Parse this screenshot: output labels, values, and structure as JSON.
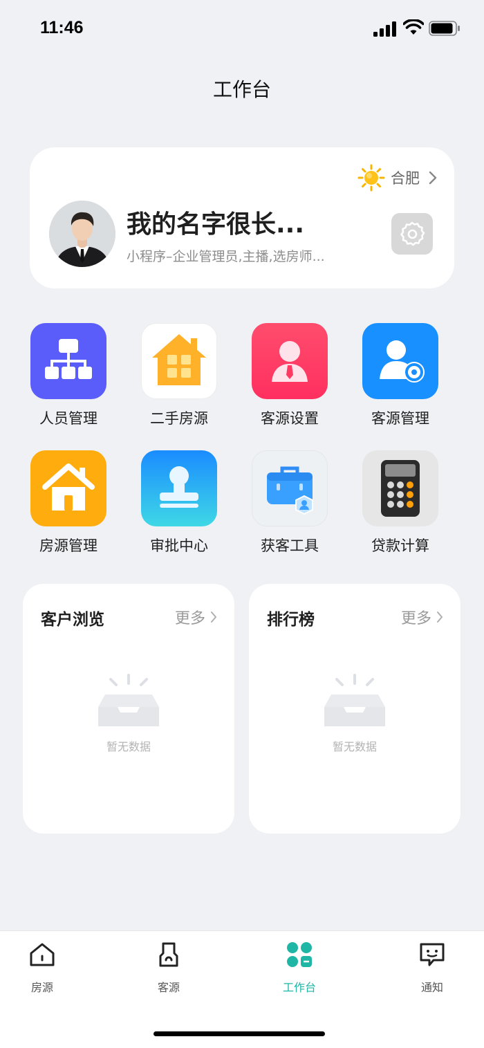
{
  "status": {
    "time": "11:46"
  },
  "header": {
    "title": "工作台"
  },
  "profile": {
    "city": "合肥",
    "name": "我的名字很长...",
    "roles": "小程序–企业管理员,主播,选房师..."
  },
  "apps": [
    {
      "label": "人员管理",
      "icon": "org-chart-icon"
    },
    {
      "label": "二手房源",
      "icon": "house-grid-icon"
    },
    {
      "label": "客源设置",
      "icon": "client-person-icon"
    },
    {
      "label": "客源管理",
      "icon": "client-settings-icon"
    },
    {
      "label": "房源管理",
      "icon": "home-icon"
    },
    {
      "label": "审批中心",
      "icon": "stamp-icon"
    },
    {
      "label": "获客工具",
      "icon": "briefcase-icon"
    },
    {
      "label": "贷款计算",
      "icon": "calculator-icon"
    }
  ],
  "panels": {
    "browse": {
      "title": "客户浏览",
      "more": "更多",
      "empty": "暂无数据"
    },
    "ranking": {
      "title": "排行榜",
      "more": "更多",
      "empty": "暂无数据"
    }
  },
  "tabs": [
    {
      "label": "房源"
    },
    {
      "label": "客源"
    },
    {
      "label": "工作台"
    },
    {
      "label": "通知"
    }
  ],
  "colors": {
    "accent": "#1fb6a6",
    "background": "#eff1f5"
  }
}
